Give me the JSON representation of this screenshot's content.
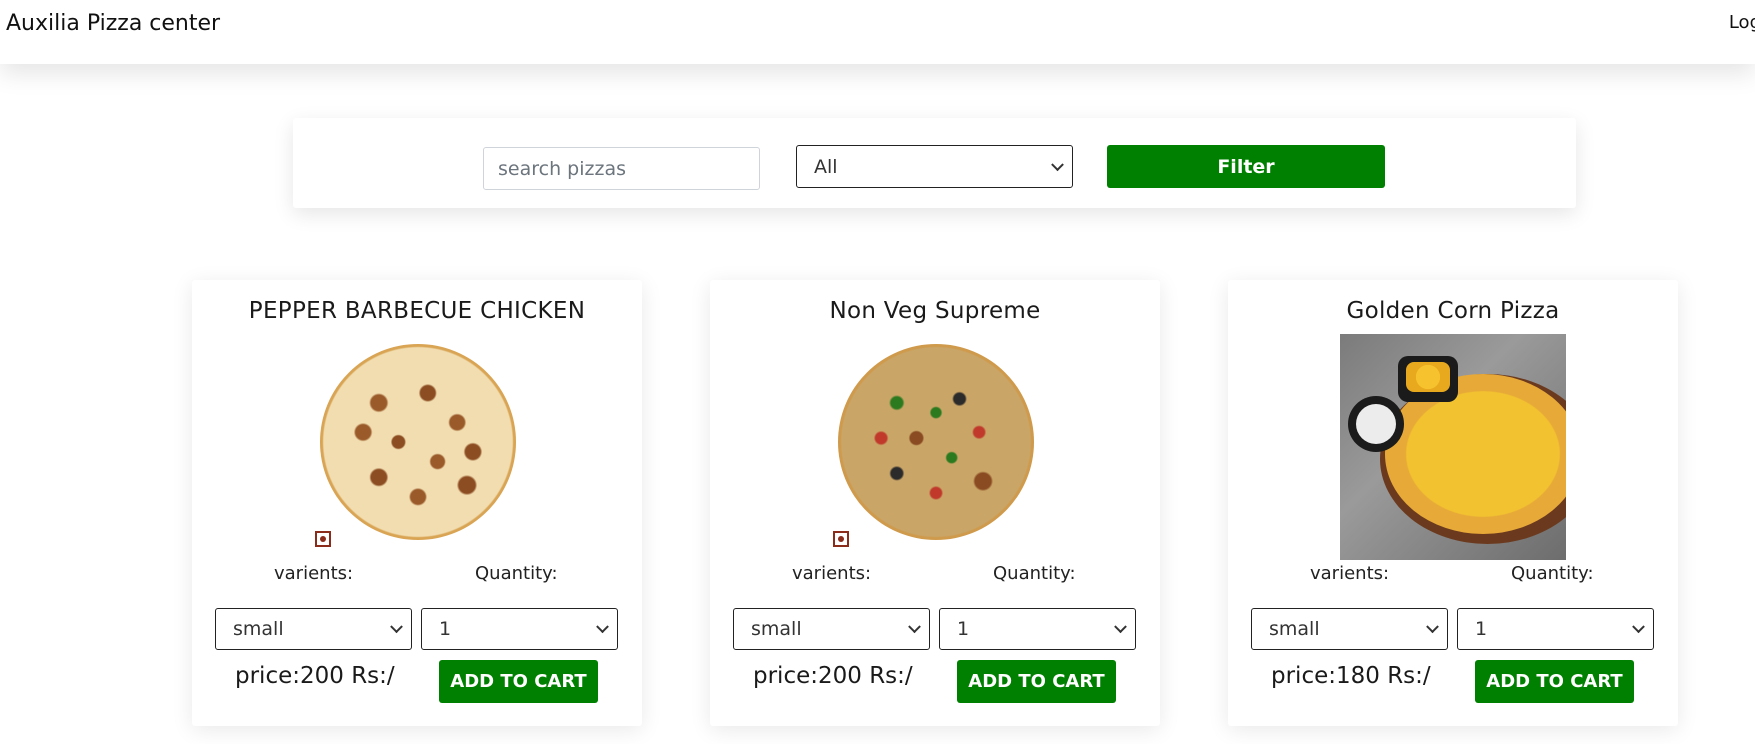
{
  "navbar": {
    "brand": "Auxilia Pizza center",
    "login_label": "Log"
  },
  "filter": {
    "search_placeholder": "search pizzas",
    "category_selected": "All",
    "filter_label": "Filter"
  },
  "labels": {
    "variants": "varients:",
    "quantity": "Quantity:",
    "add_to_cart": "ADD TO CART"
  },
  "colors": {
    "accent_green": "#008000",
    "non_veg_mark": "#8b2b1a"
  },
  "pizzas": [
    {
      "name": "PEPPER BARBECUE CHICKEN",
      "variant": "small",
      "quantity": "1",
      "price": "price:200 Rs:/",
      "image_icon": "pepper-barbecue-chicken-pizza",
      "non_veg": true
    },
    {
      "name": "Non Veg Supreme",
      "variant": "small",
      "quantity": "1",
      "price": "price:200 Rs:/",
      "image_icon": "non-veg-supreme-pizza",
      "non_veg": true
    },
    {
      "name": "Golden Corn Pizza",
      "variant": "small",
      "quantity": "1",
      "price": "price:180 Rs:/",
      "image_icon": "golden-corn-pizza",
      "non_veg": false
    }
  ]
}
